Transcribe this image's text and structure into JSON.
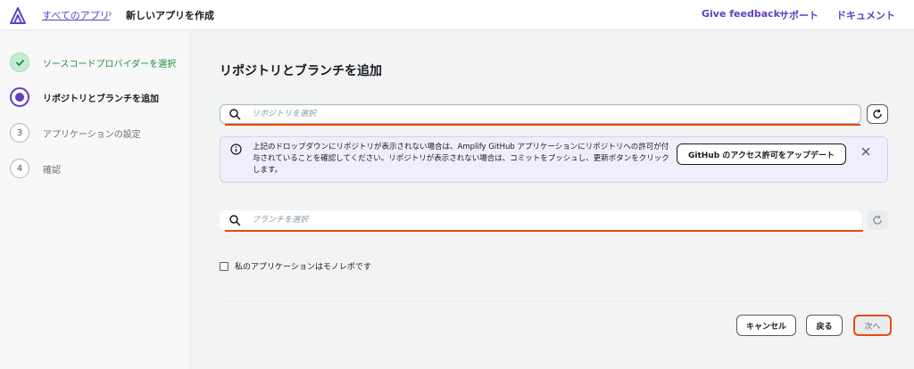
{
  "header": {
    "breadcrumb_link": "すべてのアプリ",
    "breadcrumb_separator": "›",
    "breadcrumb_current": "新しいアプリを作成",
    "nav": [
      "Give feedback",
      "サポート",
      "ドキュメント"
    ]
  },
  "sidebar": {
    "steps": [
      {
        "number": "1",
        "label": "ソースコードプロバイダーを選択",
        "state": "done"
      },
      {
        "number": "2",
        "label": "リポジトリとブランチを追加",
        "state": "current"
      },
      {
        "number": "3",
        "label": "アプリケーションの設定",
        "state": "todo"
      },
      {
        "number": "4",
        "label": "確認",
        "state": "todo"
      }
    ]
  },
  "main": {
    "title": "リポジトリとブランチを追加",
    "repo_search": {
      "placeholder": "リポジトリを選択",
      "value": ""
    },
    "info": {
      "text": "上記のドロップダウンにリポジトリが表示されない場合は、Amplify GitHub アプリケーションにリポジトリへの許可が付与されていることを確認してください。リポジトリが表示されない場合は、コミットをプッシュし、更新ボタンをクリックします。",
      "button_label": "GitHub のアクセス許可をアップデート"
    },
    "branch_search": {
      "placeholder": "ブランチを選択",
      "value": ""
    },
    "monorepo_label": "私のアプリケーションはモノレポです",
    "monorepo_checked": false
  },
  "footer": {
    "cancel_label": "キャンセル",
    "back_label": "戻る",
    "next_label": "次へ"
  },
  "colors": {
    "accent": "#5f3dc4",
    "success": "#1f8b3a",
    "highlight": "#e8490f"
  }
}
